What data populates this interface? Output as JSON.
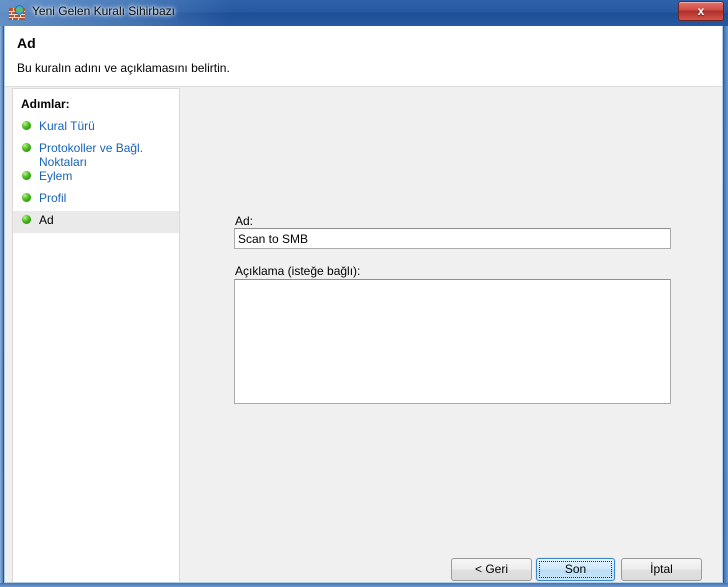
{
  "window": {
    "title": "Yeni Gelen Kuralı Sihirbazı",
    "icon": "firewall-icon",
    "close_label": "x"
  },
  "header": {
    "title": "Ad",
    "subtitle": "Bu kuralın adını ve açıklamasını belirtin."
  },
  "sidebar": {
    "heading": "Adımlar:",
    "items": [
      {
        "label": "Kural Türü",
        "current": false,
        "bullet": "green-bullet-icon"
      },
      {
        "label": "Protokoller ve Bağl. Noktaları",
        "current": false,
        "bullet": "green-bullet-icon"
      },
      {
        "label": "Eylem",
        "current": false,
        "bullet": "green-bullet-icon"
      },
      {
        "label": "Profil",
        "current": false,
        "bullet": "green-bullet-icon"
      },
      {
        "label": "Ad",
        "current": true,
        "bullet": "green-bullet-icon"
      }
    ]
  },
  "main": {
    "name_label": "Ad:",
    "name_value": "Scan to SMB",
    "description_label": "Açıklama (isteğe bağlı):",
    "description_value": ""
  },
  "footer": {
    "back_label": "< Geri",
    "finish_label": "Son",
    "cancel_label": "İptal"
  },
  "colors": {
    "titlebar_blue": "#26589f",
    "link_blue": "#1763b6",
    "bullet_green": "#56c425",
    "default_button_blue": "#3c87c8",
    "close_red": "#d04c45",
    "panel_gray": "#f0f0f0"
  }
}
